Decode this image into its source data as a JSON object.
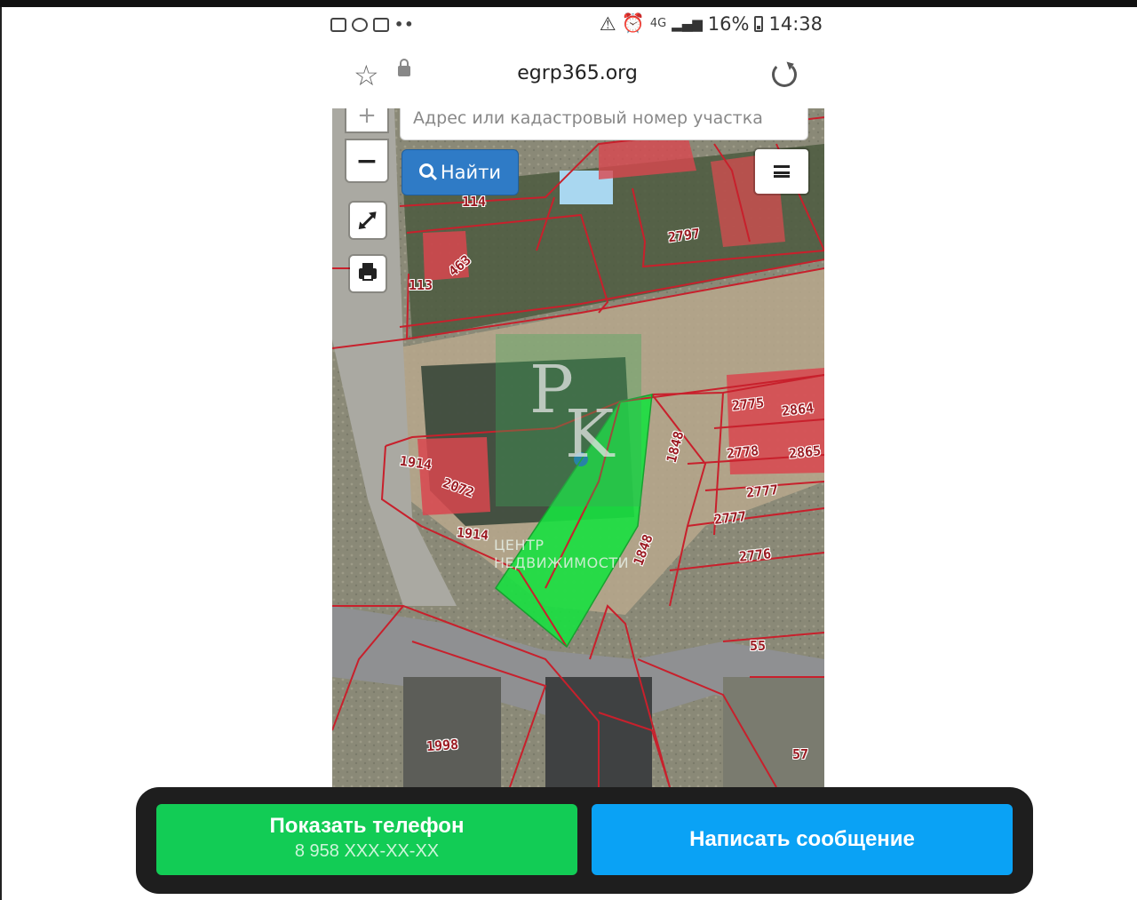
{
  "status_bar": {
    "network": "4G",
    "battery": "16%",
    "time": "14:38",
    "left_icons": [
      "gallery-icon",
      "viber-icon",
      "car-icon"
    ],
    "more": "••"
  },
  "browser": {
    "url": "egrp365.org"
  },
  "map": {
    "search_placeholder": "Адрес или кадастровый номер участка",
    "find_label": "Найти",
    "zoom_in": "+",
    "zoom_out": "−",
    "parcels": [
      "114",
      "2797",
      "463",
      "113",
      "2775",
      "2864",
      "1848",
      "2778",
      "2865",
      "1914",
      "2072",
      "2777",
      "2777",
      "1914",
      "1848",
      "2776",
      "55",
      "1998",
      "57"
    ],
    "colors": {
      "boundary": "#c8202c",
      "selected_parcel": "#18e040",
      "building_fill": "#d9474f"
    },
    "watermark": {
      "logo_p": "P",
      "logo_k": "K",
      "line1": "ЦЕНТР",
      "line2": "НЕДВИЖИМОСТИ"
    }
  },
  "actions": {
    "show_phone": "Показать телефон",
    "phone_masked": "8 958 XXX-XX-XX",
    "write_message": "Написать сообщение"
  }
}
